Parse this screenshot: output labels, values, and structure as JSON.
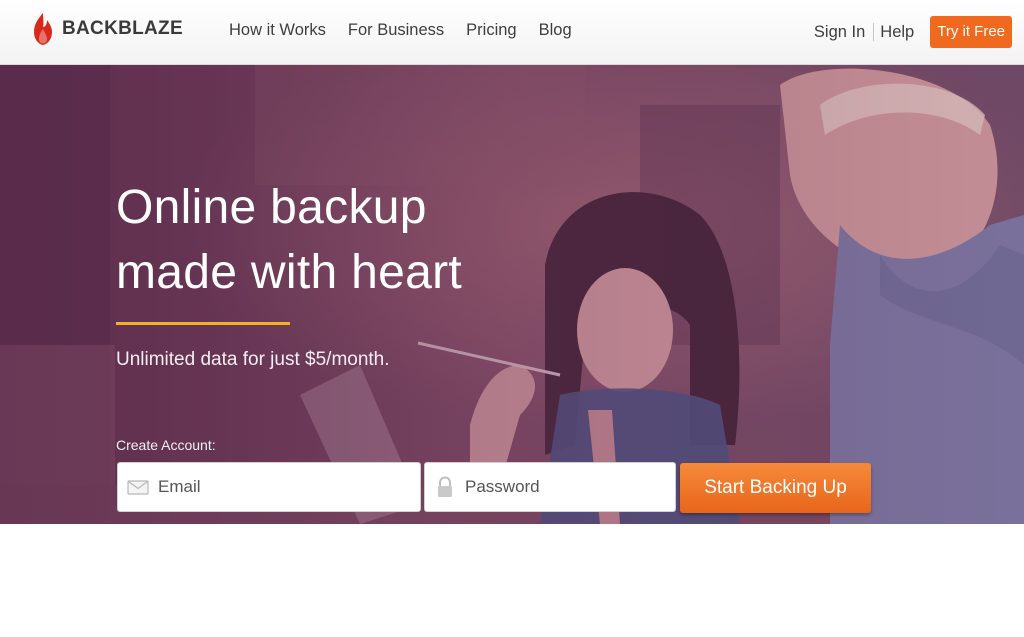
{
  "brand": {
    "name": "BACKBLAZE",
    "logo_icon": "flame-icon",
    "color": "#d9291c"
  },
  "nav": {
    "links": [
      "How it Works",
      "For Business",
      "Pricing",
      "Blog"
    ],
    "sign_in": "Sign In",
    "help": "Help",
    "try_free": "Try it Free",
    "accent": "#ef6a1f"
  },
  "hero": {
    "headline_line1": "Online backup",
    "headline_line2": "made with heart",
    "accent_rule_color": "#f0b323",
    "subline": "Unlimited data for just $5/month.",
    "create_label": "Create Account:",
    "email_placeholder": "Email",
    "email_icon": "envelope-icon",
    "password_placeholder": "Password",
    "password_icon": "lock-icon",
    "submit_label": "Start Backing Up"
  }
}
